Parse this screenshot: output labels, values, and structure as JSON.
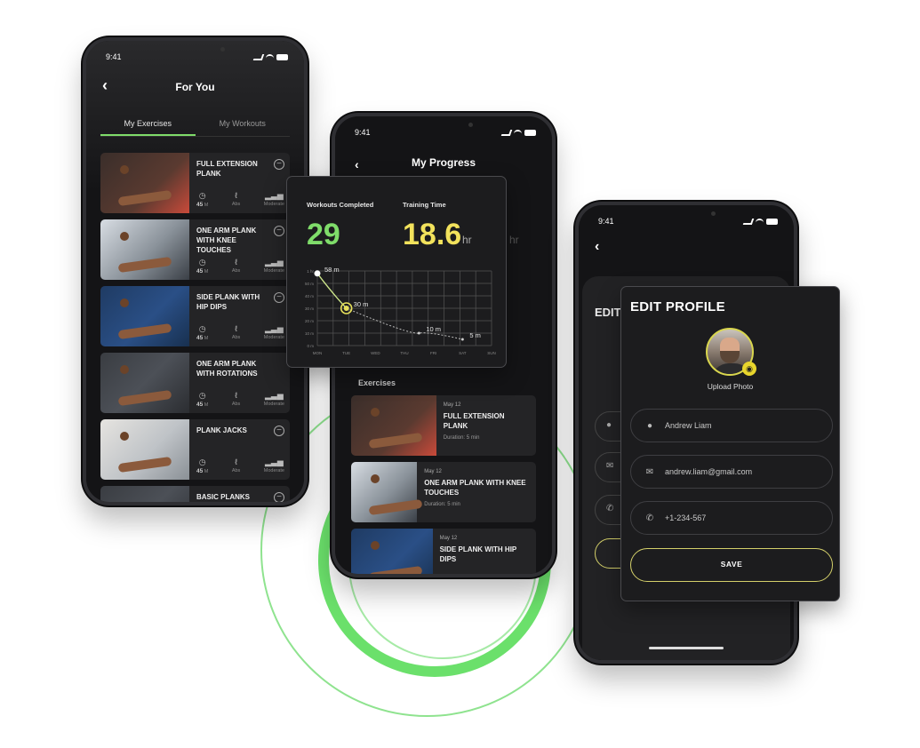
{
  "status_time": "9:41",
  "colors": {
    "accent_green": "#7fdc6a",
    "accent_yellow": "#f2e25c",
    "save_border": "#d4d06a"
  },
  "for_you": {
    "title": "For You",
    "tabs": [
      {
        "label": "My Exercises",
        "active": true
      },
      {
        "label": "My Workouts",
        "active": false
      }
    ],
    "exercises": [
      {
        "name": "FULL EXTENSION PLANK",
        "duration": "45",
        "duration_unit": "M",
        "focus": "Abs",
        "level": "Moderate"
      },
      {
        "name": "ONE ARM PLANK WITH KNEE TOUCHES",
        "duration": "45",
        "duration_unit": "M",
        "focus": "Abs",
        "level": "Moderate"
      },
      {
        "name": "SIDE PLANK WITH HIP DIPS",
        "duration": "45",
        "duration_unit": "M",
        "focus": "Abs",
        "level": "Moderate"
      },
      {
        "name": "ONE ARM PLANK WITH ROTATIONS",
        "duration": "45",
        "duration_unit": "M",
        "focus": "Abs",
        "level": "Moderate"
      },
      {
        "name": "PLANK JACKS",
        "duration": "45",
        "duration_unit": "M",
        "focus": "Abs",
        "level": "Moderate"
      },
      {
        "name": "BASIC PLANKS"
      }
    ]
  },
  "progress": {
    "title": "My Progress",
    "hr_unit_behind": "hr",
    "exercises_label": "Exercises",
    "exercises": [
      {
        "date": "May 12",
        "name": "FULL EXTENSION PLANK",
        "duration": "Duration: 5 min"
      },
      {
        "date": "May 12",
        "name": "ONE ARM PLANK WITH KNEE TOUCHES",
        "duration": "Duration: 5 min"
      },
      {
        "date": "May 12",
        "name": "SIDE PLANK WITH HIP DIPS"
      }
    ]
  },
  "progress_card": {
    "workouts_label": "Workouts Completed",
    "workouts_value": "29",
    "time_label": "Training Time",
    "time_value": "18.6",
    "time_unit": "hr"
  },
  "chart_data": {
    "type": "line",
    "categories": [
      "MON",
      "TUE",
      "WED",
      "THU",
      "FRI",
      "SAT",
      "SUN"
    ],
    "x": [
      0.0,
      1.0,
      3.5,
      5.0
    ],
    "values": [
      58,
      30,
      10,
      5
    ],
    "point_labels": [
      "58 m",
      "30 m",
      "10 m",
      "5 m"
    ],
    "highlight_index": 1,
    "ylim": [
      0,
      60
    ],
    "y_ticks": [
      0,
      10,
      20,
      30,
      40,
      50,
      60
    ],
    "y_tick_labels": [
      "0 m",
      "10 m",
      "20 m",
      "30 m",
      "40 m",
      "50 m",
      "1 hr"
    ],
    "grid": true
  },
  "edit_profile": {
    "short_title": "EDIT",
    "title": "EDIT PROFILE",
    "upload_label": "Upload Photo",
    "name": "Andrew Liam",
    "email": "andrew.liam@gmail.com",
    "phone": "+1-234-567",
    "save_label": "SAVE",
    "icons": {
      "name": "user-icon",
      "email": "envelope-icon",
      "phone": "phone-icon",
      "camera": "camera-icon"
    }
  }
}
